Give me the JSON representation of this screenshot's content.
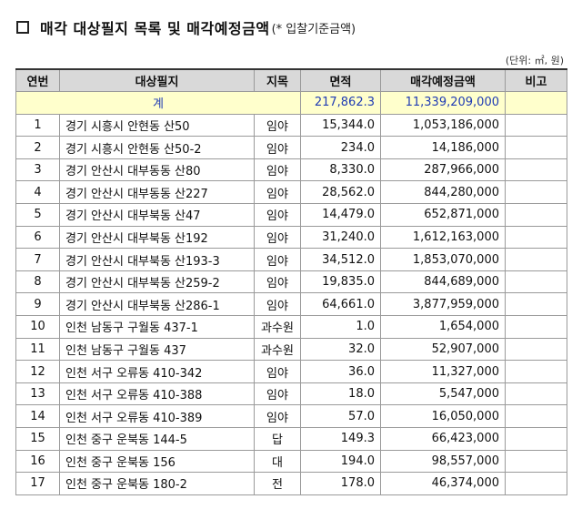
{
  "title": {
    "main": "매각 대상필지 목록 및 매각예정금액",
    "sub": "(* 입찰기준금액)"
  },
  "unit": "(단위: ㎡, 원)",
  "columns": [
    "연번",
    "대상필지",
    "지목",
    "면적",
    "매각예정금액",
    "비고"
  ],
  "total": {
    "label": "계",
    "area": "217,862.3",
    "amount": "11,339,209,000"
  },
  "rows": [
    {
      "no": "1",
      "parcel": "경기 시흥시 안현동 산50",
      "type": "임야",
      "area": "15,344.0",
      "amount": "1,053,186,000",
      "note": ""
    },
    {
      "no": "2",
      "parcel": "경기 시흥시 안현동 산50-2",
      "type": "임야",
      "area": "234.0",
      "amount": "14,186,000",
      "note": ""
    },
    {
      "no": "3",
      "parcel": "경기 안산시 대부동동 산80",
      "type": "임야",
      "area": "8,330.0",
      "amount": "287,966,000",
      "note": ""
    },
    {
      "no": "4",
      "parcel": "경기 안산시 대부동동 산227",
      "type": "임야",
      "area": "28,562.0",
      "amount": "844,280,000",
      "note": ""
    },
    {
      "no": "5",
      "parcel": "경기 안산시 대부북동 산47",
      "type": "임야",
      "area": "14,479.0",
      "amount": "652,871,000",
      "note": ""
    },
    {
      "no": "6",
      "parcel": "경기 안산시 대부북동 산192",
      "type": "임야",
      "area": "31,240.0",
      "amount": "1,612,163,000",
      "note": ""
    },
    {
      "no": "7",
      "parcel": "경기 안산시 대부북동 산193-3",
      "type": "임야",
      "area": "34,512.0",
      "amount": "1,853,070,000",
      "note": ""
    },
    {
      "no": "8",
      "parcel": "경기 안산시 대부북동 산259-2",
      "type": "임야",
      "area": "19,835.0",
      "amount": "844,689,000",
      "note": ""
    },
    {
      "no": "9",
      "parcel": "경기 안산시 대부북동 산286-1",
      "type": "임야",
      "area": "64,661.0",
      "amount": "3,877,959,000",
      "note": ""
    },
    {
      "no": "10",
      "parcel": "인천 남동구 구월동 437-1",
      "type": "과수원",
      "area": "1.0",
      "amount": "1,654,000",
      "note": ""
    },
    {
      "no": "11",
      "parcel": "인천 남동구 구월동 437",
      "type": "과수원",
      "area": "32.0",
      "amount": "52,907,000",
      "note": ""
    },
    {
      "no": "12",
      "parcel": "인천 서구 오류동 410-342",
      "type": "임야",
      "area": "36.0",
      "amount": "11,327,000",
      "note": ""
    },
    {
      "no": "13",
      "parcel": "인천 서구 오류동 410-388",
      "type": "임야",
      "area": "18.0",
      "amount": "5,547,000",
      "note": ""
    },
    {
      "no": "14",
      "parcel": "인천 서구 오류동 410-389",
      "type": "임야",
      "area": "57.0",
      "amount": "16,050,000",
      "note": ""
    },
    {
      "no": "15",
      "parcel": "인천 중구 운북동 144-5",
      "type": "답",
      "area": "149.3",
      "amount": "66,423,000",
      "note": ""
    },
    {
      "no": "16",
      "parcel": "인천 중구 운북동 156",
      "type": "대",
      "area": "194.0",
      "amount": "98,557,000",
      "note": ""
    },
    {
      "no": "17",
      "parcel": "인천 중구 운북동 180-2",
      "type": "전",
      "area": "178.0",
      "amount": "46,374,000",
      "note": ""
    }
  ]
}
